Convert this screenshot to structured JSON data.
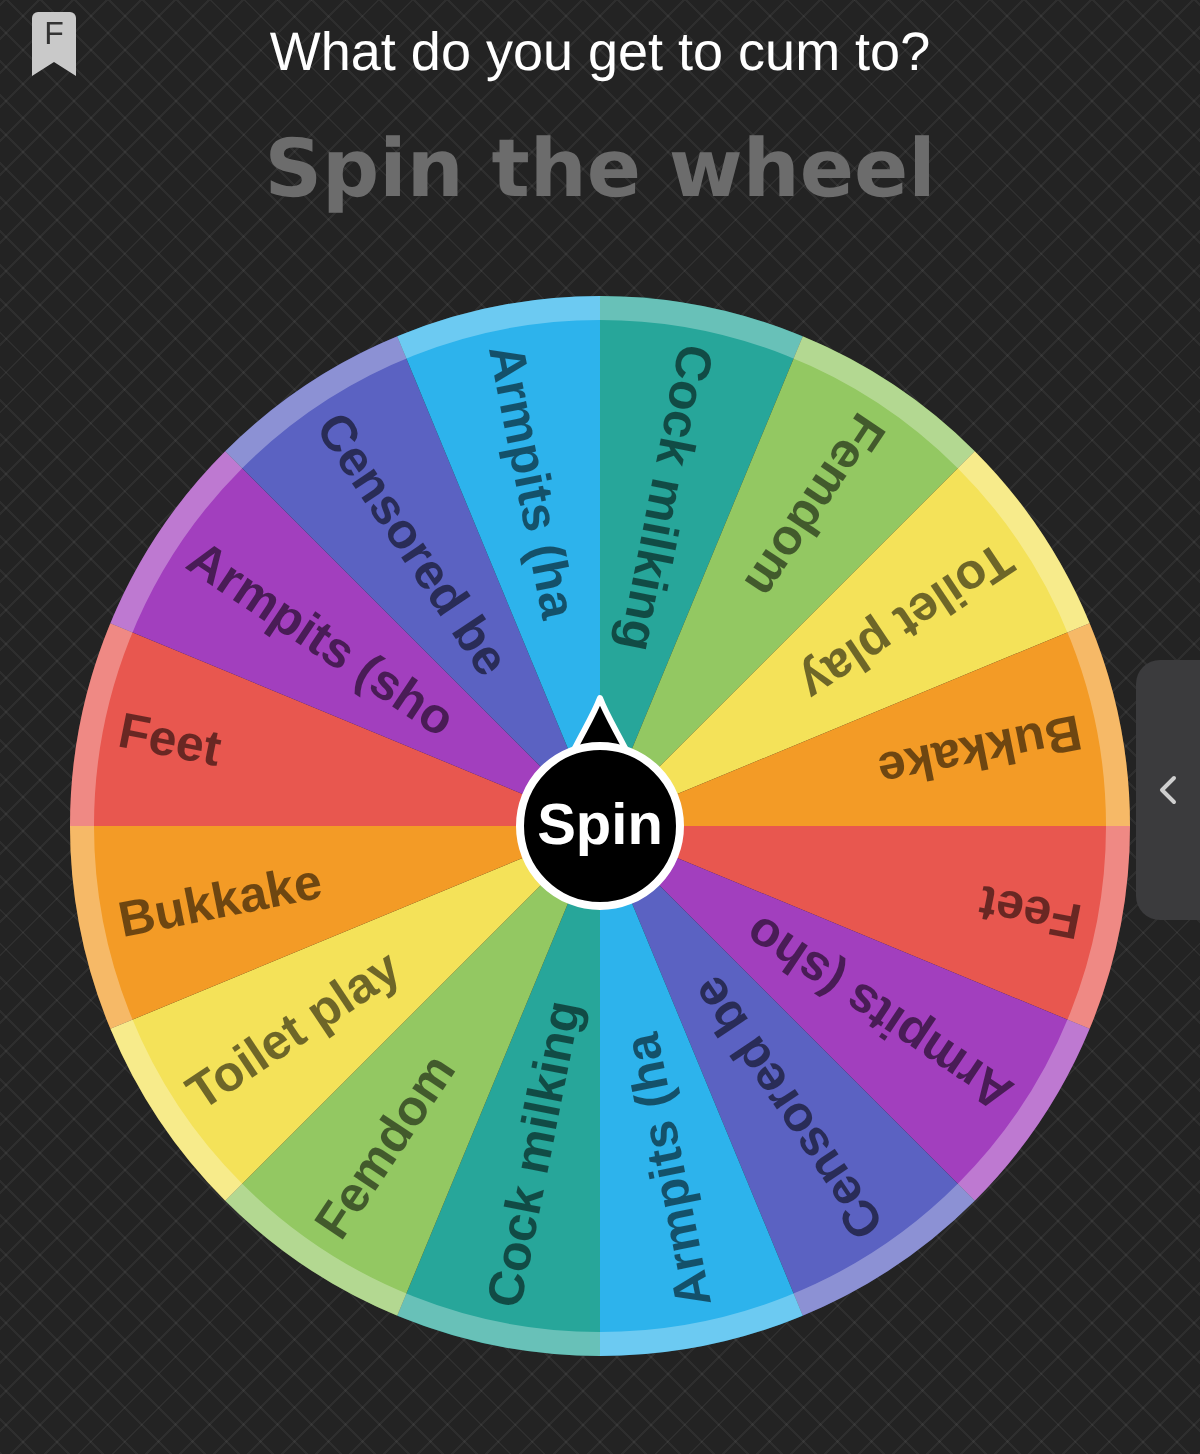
{
  "header": {
    "bookmark_letter": "F",
    "title": "What do you get to cum to?"
  },
  "subtitle": "Spin the wheel",
  "wheel": {
    "spin_label": "Spin",
    "segments": [
      {
        "label": "Cock milking",
        "color": "#27a69a"
      },
      {
        "label": "Femdom",
        "color": "#93c862"
      },
      {
        "label": "Toilet play",
        "color": "#f4e259"
      },
      {
        "label": "Bukkake",
        "color": "#f39b26"
      },
      {
        "label": "Feet",
        "color": "#e8574f"
      },
      {
        "label": "Armpits (sho",
        "color": "#a23fbe"
      },
      {
        "label": "Censored be",
        "color": "#5b62c2"
      },
      {
        "label": "Armpits (ha",
        "color": "#2db3ec"
      },
      {
        "label": "Cock milking",
        "color": "#27a69a"
      },
      {
        "label": "Femdom",
        "color": "#93c862"
      },
      {
        "label": "Toilet play",
        "color": "#f4e259"
      },
      {
        "label": "Bukkake",
        "color": "#f39b26"
      },
      {
        "label": "Feet",
        "color": "#e8574f"
      },
      {
        "label": "Armpits (sho",
        "color": "#a23fbe"
      },
      {
        "label": "Censored be",
        "color": "#5b62c2"
      },
      {
        "label": "Armpits (ha",
        "color": "#2db3ec"
      }
    ]
  }
}
